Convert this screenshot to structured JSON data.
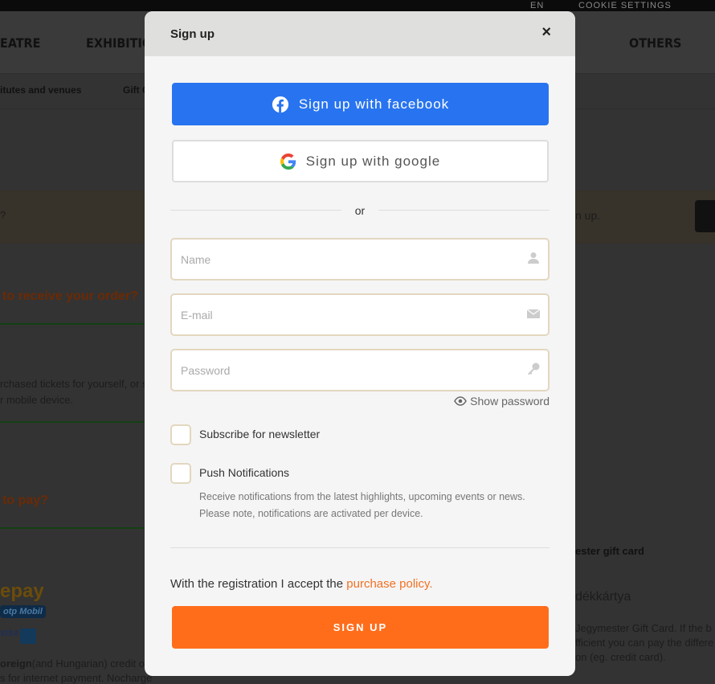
{
  "background": {
    "topbar": {
      "language": "EN",
      "cookie_settings": "COOKIE SETTINGS"
    },
    "nav": [
      "EATRE",
      "EXHIBITION",
      "OTHERS"
    ],
    "subnav": [
      "itutes and venues",
      "Gift C"
    ],
    "banner": {
      "left_text": "?",
      "right_text": "n up."
    },
    "receive_heading": "to receive your order?",
    "receive_text": [
      "rchased tickets for yourself, or s",
      "r mobile device."
    ],
    "pay_heading": "to pay?",
    "pay_logos": {
      "simplepay": "epay",
      "otp": "otp Mobil",
      "visa": "VISA"
    },
    "pay_text": [
      "oreign",
      "(and Hungarian) credit or",
      "s for internet payment. Nocharge"
    ],
    "gift_card_title": "ester gift card",
    "gift_card_heading": "dékkártya",
    "gift_card_text": [
      "Jegymester Gift Card. If the b",
      "fficient you can pay the differe",
      "on (eg. credit card)."
    ]
  },
  "modal": {
    "title": "Sign up",
    "close": "×",
    "facebook_label": "Sign up with facebook",
    "google_label": "Sign up with google",
    "or": "or",
    "name_placeholder": "Name",
    "email_placeholder": "E-mail",
    "password_placeholder": "Password",
    "show_password": "Show password",
    "newsletter_label": "Subscribe for newsletter",
    "push_label": "Push Notifications",
    "push_note_1": "Receive notifications from the latest highlights, upcoming events or news.",
    "push_note_2": "Please note, notifications are activated per device.",
    "policy_text": "With the registration I accept the ",
    "policy_link": "purchase policy.",
    "submit_label": "SIGN UP",
    "colors": {
      "facebook": "#2874f0",
      "accent": "#ff6d1b",
      "link": "#f37021"
    }
  }
}
